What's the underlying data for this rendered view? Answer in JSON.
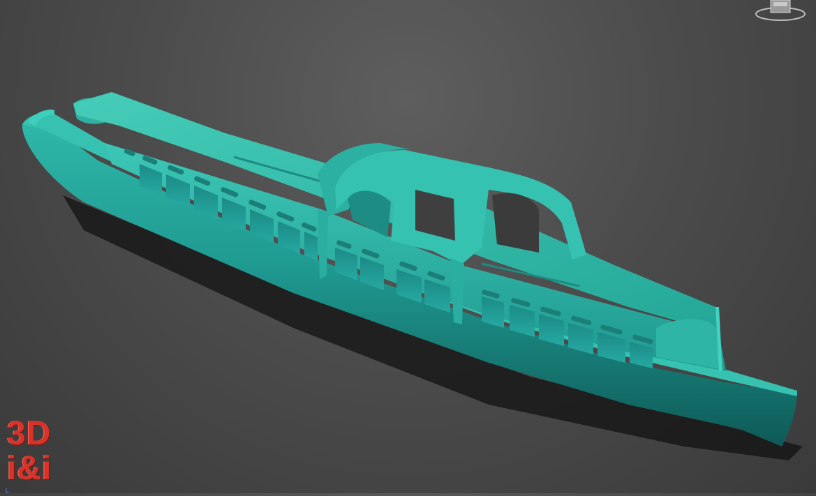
{
  "app": {
    "context": "3d-viewport"
  },
  "viewport": {
    "background_color": "#4c4c4c",
    "model_color": "#2aa59a",
    "shadow_color": "#0a0a0a"
  },
  "viewcube": {
    "icon": "viewcube-icon"
  },
  "watermark": {
    "line1": "3D",
    "line2": "i&i",
    "color": "#d8332a"
  },
  "axis_indicator": {
    "icon": "axis-tripod-icon"
  }
}
